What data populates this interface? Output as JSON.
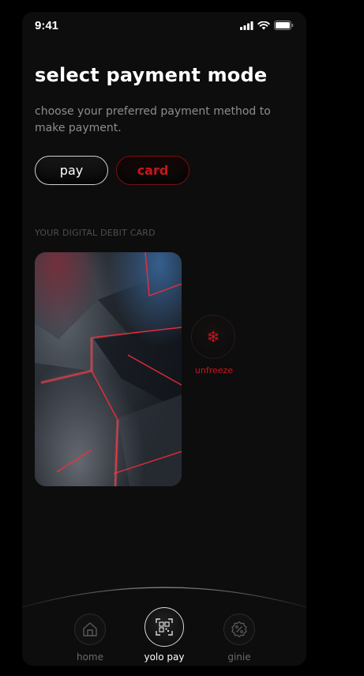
{
  "status_bar": {
    "time": "9:41",
    "icons": [
      "signal-icon",
      "wifi-icon",
      "battery-icon"
    ]
  },
  "header": {
    "title": "select payment mode",
    "subtitle": "choose your preferred payment method to make payment."
  },
  "mode_toggle": {
    "options": [
      {
        "label": "pay",
        "selected": false
      },
      {
        "label": "card",
        "selected": true
      }
    ]
  },
  "card_section": {
    "label": "YOUR DIGITAL DEBIT CARD",
    "freeze_icon": "snowflake-icon",
    "freeze_label": "unfreeze"
  },
  "bottom_nav": {
    "items": [
      {
        "label": "home",
        "icon": "home-icon",
        "active": false
      },
      {
        "label": "yolo pay",
        "icon": "qr-code-icon",
        "active": true
      },
      {
        "label": "ginie",
        "icon": "percent-badge-icon",
        "active": false
      }
    ]
  },
  "colors": {
    "background": "#0d0d0d",
    "accent_red": "#c8161b",
    "text_primary": "#ffffff",
    "text_muted": "#8d8d8d"
  }
}
